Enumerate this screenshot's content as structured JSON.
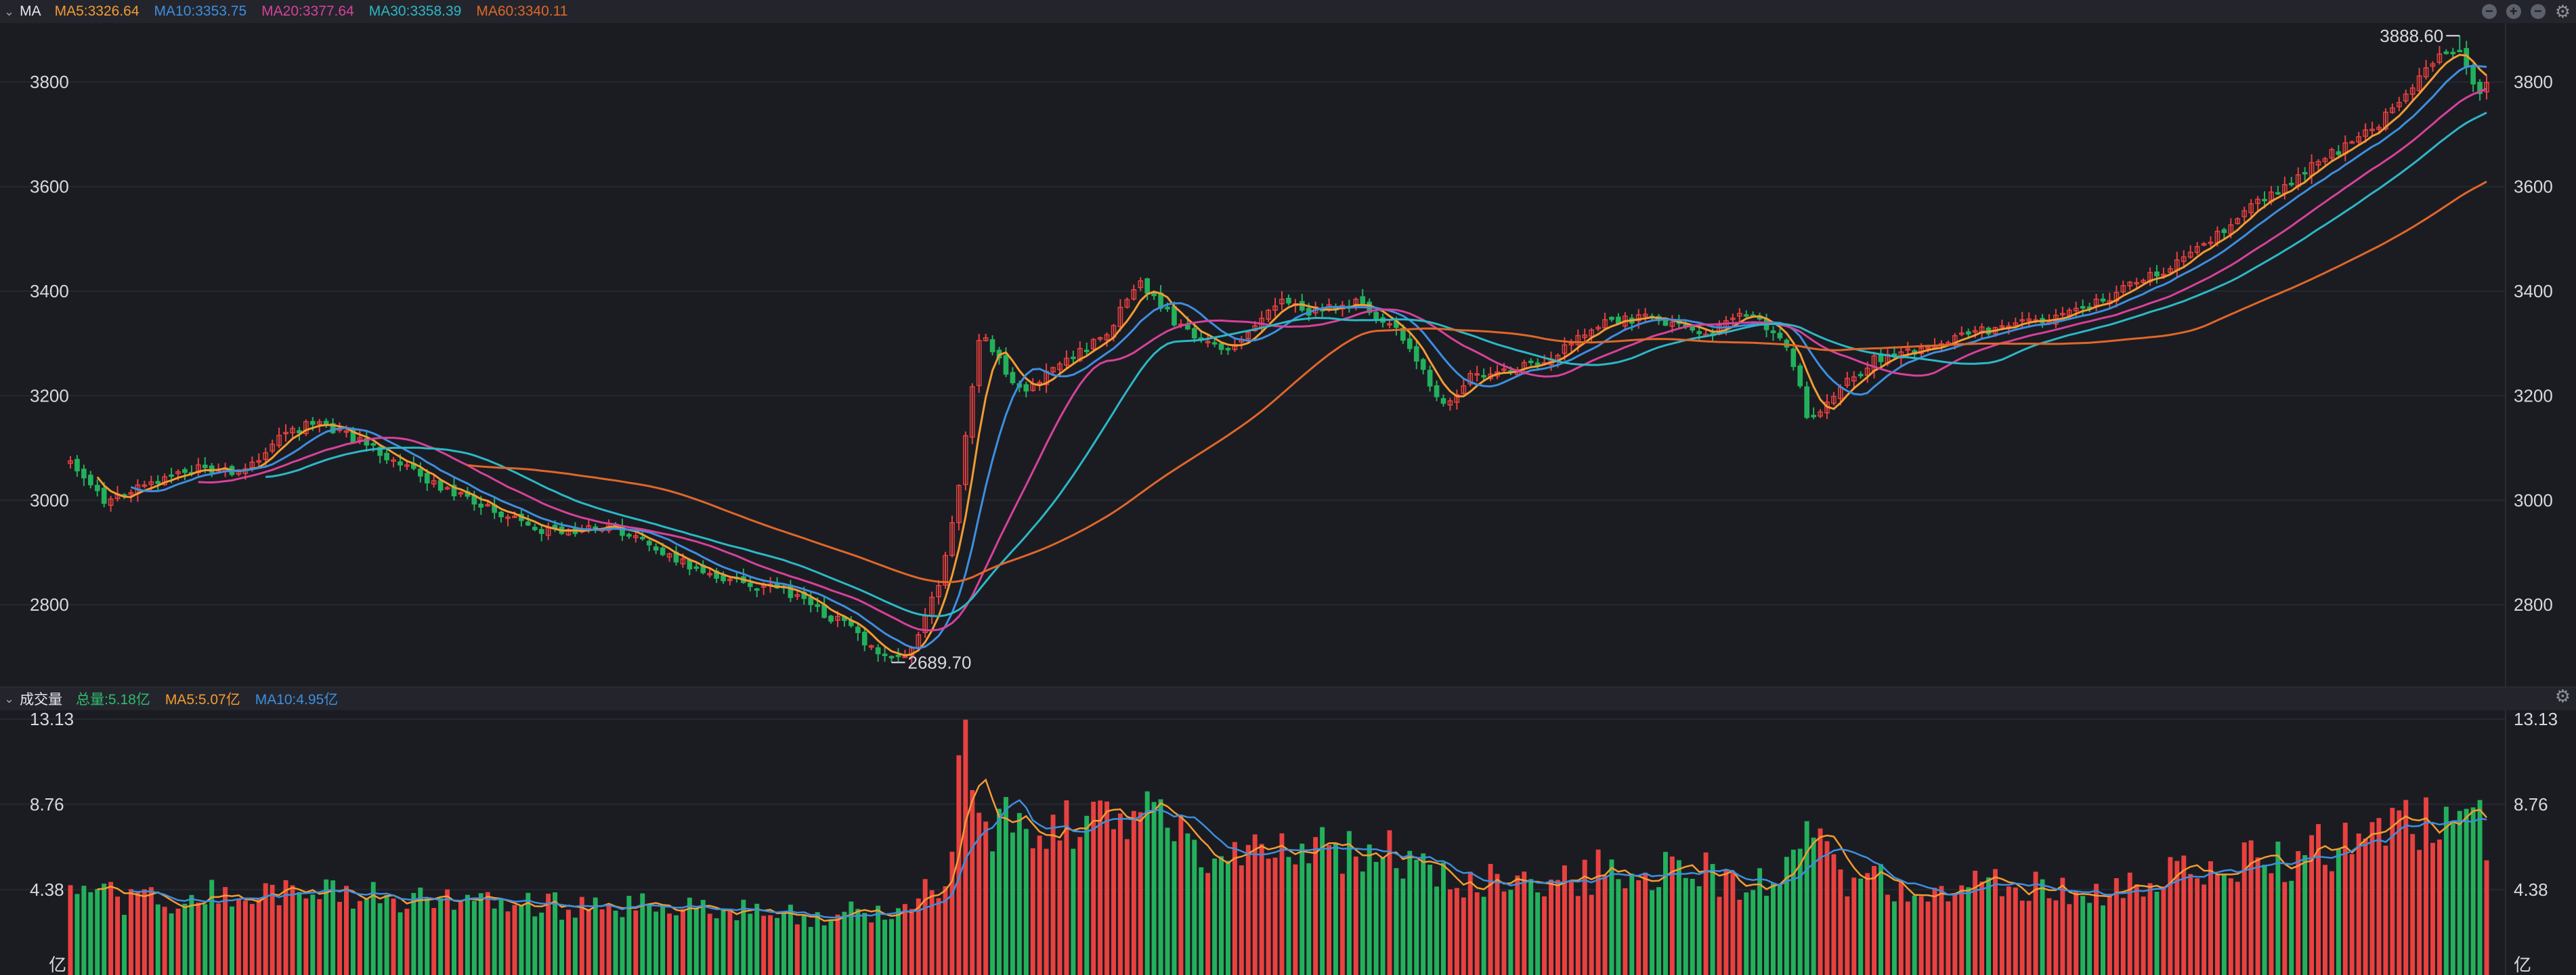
{
  "header": {
    "label": "MA",
    "ma": [
      {
        "text": "MA5:3326.64",
        "color": "#f39c33"
      },
      {
        "text": "MA10:3353.75",
        "color": "#3d8fe0"
      },
      {
        "text": "MA20:3377.64",
        "color": "#d6429a"
      },
      {
        "text": "MA30:3358.39",
        "color": "#2cb8c6"
      },
      {
        "text": "MA60:3340.11",
        "color": "#e0672a"
      }
    ],
    "tool_icons": [
      "minus-circle-icon",
      "plus-circle-icon",
      "minus-circle-icon",
      "gear-icon"
    ]
  },
  "volume_header": {
    "label": "成交量",
    "items": [
      {
        "text": "总量:5.18亿",
        "color": "#2ebd6e"
      },
      {
        "text": "MA5:5.07亿",
        "color": "#f39c33"
      },
      {
        "text": "MA10:4.95亿",
        "color": "#3d8fe0"
      }
    ]
  },
  "colors": {
    "up": "#e8413f",
    "down": "#23b05c",
    "background": "#1b1c22",
    "grid": "#262830"
  },
  "chart_data": [
    {
      "type": "candlestick",
      "title": "",
      "yticks": [
        2800,
        3000,
        3200,
        3400,
        3600,
        3800
      ],
      "ylim": [
        2650,
        3900
      ],
      "annotations": {
        "high": "3888.60",
        "low": "2689.70"
      },
      "candle_count": 360,
      "key_points": [
        [
          0,
          3080
        ],
        [
          8,
          3000
        ],
        [
          30,
          3060
        ],
        [
          40,
          3050
        ],
        [
          50,
          3130
        ],
        [
          58,
          3150
        ],
        [
          70,
          3100
        ],
        [
          85,
          3030
        ],
        [
          100,
          2970
        ],
        [
          110,
          2940
        ],
        [
          125,
          2950
        ],
        [
          140,
          2890
        ],
        [
          150,
          2850
        ],
        [
          165,
          2830
        ],
        [
          180,
          2760
        ],
        [
          185,
          2720
        ],
        [
          190,
          2689.7
        ],
        [
          195,
          2720
        ],
        [
          201,
          2830
        ],
        [
          205,
          2980
        ],
        [
          208,
          3150
        ],
        [
          211,
          3330
        ],
        [
          214,
          3280
        ],
        [
          220,
          3210
        ],
        [
          230,
          3260
        ],
        [
          240,
          3320
        ],
        [
          248,
          3420
        ],
        [
          255,
          3350
        ],
        [
          262,
          3300
        ],
        [
          270,
          3290
        ],
        [
          280,
          3380
        ],
        [
          288,
          3360
        ],
        [
          298,
          3380
        ],
        [
          308,
          3320
        ],
        [
          318,
          3180
        ],
        [
          325,
          3240
        ],
        [
          340,
          3260
        ],
        [
          355,
          3340
        ],
        [
          365,
          3350
        ],
        [
          380,
          3320
        ],
        [
          388,
          3360
        ],
        [
          398,
          3300
        ],
        [
          403,
          3150
        ],
        [
          408,
          3200
        ],
        [
          418,
          3270
        ],
        [
          430,
          3290
        ],
        [
          440,
          3320
        ],
        [
          455,
          3340
        ],
        [
          470,
          3380
        ],
        [
          490,
          3460
        ],
        [
          505,
          3560
        ],
        [
          520,
          3640
        ],
        [
          535,
          3720
        ],
        [
          548,
          3840
        ],
        [
          553,
          3870
        ],
        [
          558,
          3780
        ],
        [
          560,
          3800
        ]
      ],
      "ma_lines": [
        {
          "name": "MA5",
          "color": "#f39c33"
        },
        {
          "name": "MA10",
          "color": "#3d8fe0"
        },
        {
          "name": "MA20",
          "color": "#d6429a"
        },
        {
          "name": "MA30",
          "color": "#2cb8c6"
        },
        {
          "name": "MA60",
          "color": "#e0672a"
        }
      ]
    },
    {
      "type": "bar",
      "title": "",
      "ylabel": "亿",
      "yticks": [
        "4.38",
        "8.76",
        "13.13"
      ],
      "ylim": [
        0,
        13.13
      ],
      "unit": "亿",
      "key_points": [
        [
          0,
          3.9
        ],
        [
          30,
          4.0
        ],
        [
          60,
          4.2
        ],
        [
          100,
          3.6
        ],
        [
          140,
          3.4
        ],
        [
          170,
          3.1
        ],
        [
          195,
          3.3
        ],
        [
          203,
          5.2
        ],
        [
          207,
          13.1
        ],
        [
          212,
          8.0
        ],
        [
          225,
          7.0
        ],
        [
          245,
          8.5
        ],
        [
          260,
          6.8
        ],
        [
          280,
          6.2
        ],
        [
          300,
          6.6
        ],
        [
          320,
          5.1
        ],
        [
          340,
          4.6
        ],
        [
          360,
          5.6
        ],
        [
          380,
          5.2
        ],
        [
          395,
          4.6
        ],
        [
          403,
          7.0
        ],
        [
          410,
          5.0
        ],
        [
          430,
          4.3
        ],
        [
          450,
          4.5
        ],
        [
          470,
          4.3
        ],
        [
          490,
          5.3
        ],
        [
          510,
          6.0
        ],
        [
          530,
          6.7
        ],
        [
          545,
          7.6
        ],
        [
          560,
          7.4
        ]
      ]
    }
  ]
}
